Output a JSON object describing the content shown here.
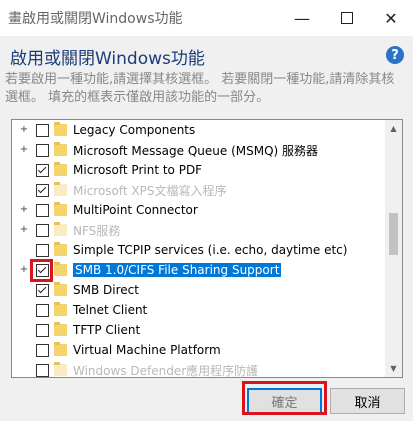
{
  "window": {
    "title": "啟用或關閉Windows功能",
    "title_icon_char": "畫",
    "controls": {
      "minimize": "—",
      "maximize": "",
      "close": "✕"
    }
  },
  "heading": "啟用或關閉Windows功能",
  "help_label": "?",
  "description": "若要啟用一種功能,請選擇其核選框。 若要關閉一種功能,請清除其核選框。 填充的框表示僅啟用該功能的一部分。",
  "features": [
    {
      "label": "Legacy Components",
      "expandable": true,
      "checked": false,
      "ghost": false,
      "selected": false
    },
    {
      "label": "Microsoft Message Queue (MSMQ) 服務器",
      "expandable": true,
      "checked": false,
      "ghost": false,
      "selected": false
    },
    {
      "label": "Microsoft Print to PDF",
      "expandable": false,
      "checked": true,
      "ghost": false,
      "selected": false
    },
    {
      "label": "Microsoft XPS文檔寫入程序",
      "expandable": false,
      "checked": true,
      "ghost": true,
      "selected": false
    },
    {
      "label": "MultiPoint Connector",
      "expandable": true,
      "checked": false,
      "ghost": false,
      "selected": false
    },
    {
      "label": "NFS服務",
      "expandable": true,
      "checked": false,
      "ghost": true,
      "selected": false
    },
    {
      "label": "Simple TCPIP services (i.e. echo, daytime etc)",
      "expandable": false,
      "checked": false,
      "ghost": false,
      "selected": false
    },
    {
      "label": "SMB 1.0/CIFS File Sharing Support",
      "expandable": true,
      "checked": true,
      "ghost": false,
      "selected": true
    },
    {
      "label": "SMB Direct",
      "expandable": false,
      "checked": true,
      "ghost": false,
      "selected": false
    },
    {
      "label": "Telnet Client",
      "expandable": false,
      "checked": false,
      "ghost": false,
      "selected": false
    },
    {
      "label": "TFTP Client",
      "expandable": false,
      "checked": false,
      "ghost": false,
      "selected": false
    },
    {
      "label": "Virtual Machine Platform",
      "expandable": false,
      "checked": false,
      "ghost": false,
      "selected": false
    },
    {
      "label": "Windows Defender應用程序防護",
      "expandable": false,
      "checked": false,
      "ghost": true,
      "selected": false
    }
  ],
  "buttons": {
    "ok": "確定",
    "cancel": "取消"
  },
  "colors": {
    "selection": "#0078d7",
    "highlight": "#d8141e",
    "heading": "#1a3c7a",
    "folder": "#f5d46b"
  },
  "icons": {
    "expander": "plus-expander-icon",
    "folder": "folder-icon",
    "help": "help-icon"
  }
}
